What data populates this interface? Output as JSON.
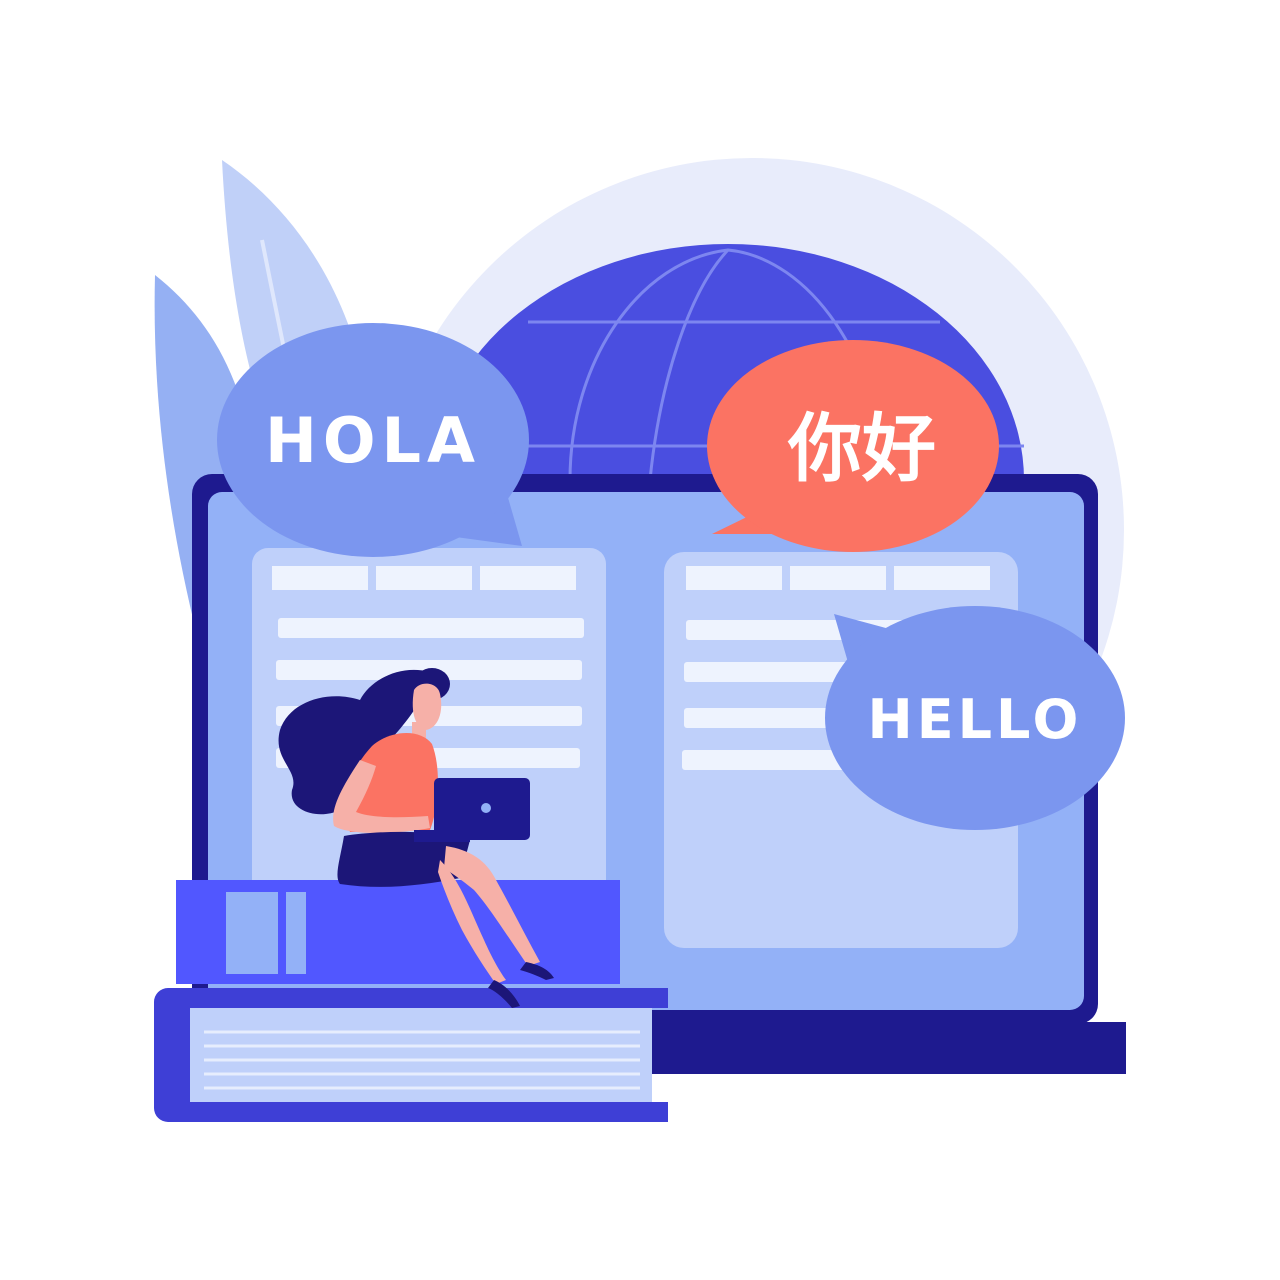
{
  "bubbles": {
    "hola": "HOLA",
    "nihao": "你好",
    "hello": "HELLO"
  },
  "colors": {
    "background": "#ffffff",
    "halo": "#e8ecfb",
    "globe": "#4a4ee0",
    "laptop_frame": "#1e1a8f",
    "laptop_screen": "#93b1f7",
    "panel": "#bfd0fa",
    "panel_row": "#eef3fe",
    "bubble_blue": "#7b96ef",
    "bubble_coral": "#fb7363",
    "book": "#5157ff",
    "book_dark": "#3e3fd6",
    "hair_skirt": "#1c1678",
    "shirt": "#fb7363",
    "skin": "#f6b0a8"
  },
  "icons": [
    "leaf-icon",
    "globe-icon",
    "laptop-icon",
    "speech-bubble-icon",
    "book-icon",
    "woman-figure-icon"
  ]
}
